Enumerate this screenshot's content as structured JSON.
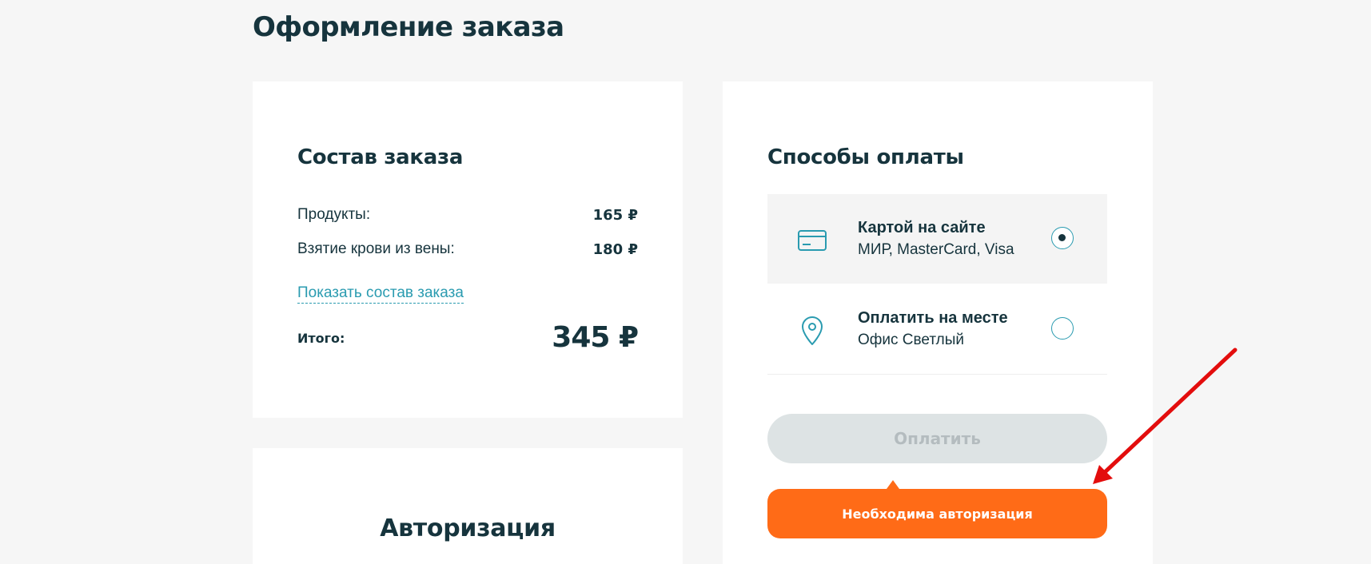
{
  "page": {
    "title": "Оформление заказа"
  },
  "order": {
    "heading": "Состав заказа",
    "rows": [
      {
        "label": "Продукты:",
        "amount": "165 ₽"
      },
      {
        "label": "Взятие крови из вены:",
        "amount": "180 ₽"
      }
    ],
    "show_link": "Показать состав заказа",
    "total_label": "Итого:",
    "total_amount": "345 ₽"
  },
  "auth": {
    "heading": "Авторизация"
  },
  "payment": {
    "heading": "Способы оплаты",
    "options": [
      {
        "title": "Картой на сайте",
        "subtitle": "МИР, MasterCard, Visa",
        "icon": "credit-card-icon",
        "selected": true
      },
      {
        "title": "Оплатить на месте",
        "subtitle": "Офис Светлый",
        "icon": "location-pin-icon",
        "selected": false
      }
    ],
    "pay_button": "Оплатить",
    "auth_notice": "Необходима авторизация"
  },
  "colors": {
    "accent": "#2a9bb0",
    "primary_text": "#16343d",
    "notice": "#ff6b17",
    "annotation_arrow": "#e30d0d"
  }
}
